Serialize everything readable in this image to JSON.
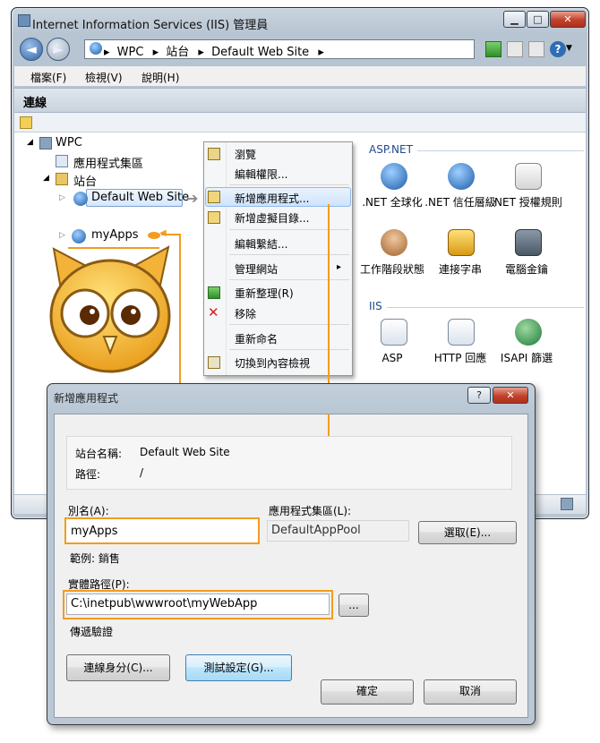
{
  "window": {
    "title": "Internet Information Services (IIS) 管理員",
    "controls": {
      "minimize": "▁",
      "maximize": "□",
      "close": "✕"
    }
  },
  "address": {
    "crumbs": [
      "WPC",
      "站台",
      "Default Web Site"
    ],
    "separator": "▸"
  },
  "menu": [
    "檔案(F)",
    "檢視(V)",
    "說明(H)"
  ],
  "connections": {
    "title": "連線"
  },
  "tree": {
    "root": "WPC",
    "app_pools": "應用程式集區",
    "sites": "站台",
    "default_site": "Default Web Site",
    "myapps": "myApps"
  },
  "context_menu": {
    "items": [
      "瀏覽",
      "編輯權限...",
      "新增應用程式...",
      "新增虛擬目錄...",
      "編輯繫結...",
      "管理網站",
      "重新整理(R)",
      "移除",
      "重新命名",
      "切換到內容檢視"
    ],
    "submenu_arrow": "▸"
  },
  "features": {
    "aspnet_group": "ASP.NET",
    "iis_group": "IIS",
    "aspnet": [
      ".NET 全球化",
      ".NET 信任層級",
      ".NET 授權規則",
      "工作階段狀態",
      "連接字串",
      "電腦金鑰"
    ],
    "iis": [
      "ASP",
      "HTTP 回應",
      "ISAPI 篩選"
    ]
  },
  "dialog": {
    "title": "新增應用程式",
    "help_btn": "?",
    "close_btn": "✕",
    "site_name_label": "站台名稱:",
    "site_name_value": "Default Web Site",
    "path_label": "路徑:",
    "path_value": "/",
    "alias_label": "別名(A):",
    "alias_value": "myApps",
    "example": "範例: 銷售",
    "pool_label": "應用程式集區(L):",
    "pool_value": "DefaultAppPool",
    "select_btn": "選取(E)...",
    "physical_label": "實體路徑(P):",
    "physical_value": "C:\\inetpub\\wwwroot\\myWebApp",
    "browse_btn": "...",
    "pass_through": "傳遞驗證",
    "connect_as_btn": "連線身分(C)...",
    "test_btn": "測試設定(G)...",
    "ok_btn": "確定",
    "cancel_btn": "取消"
  },
  "colors": {
    "accent": "#f39c1f",
    "selection": "#d6e7fb"
  }
}
